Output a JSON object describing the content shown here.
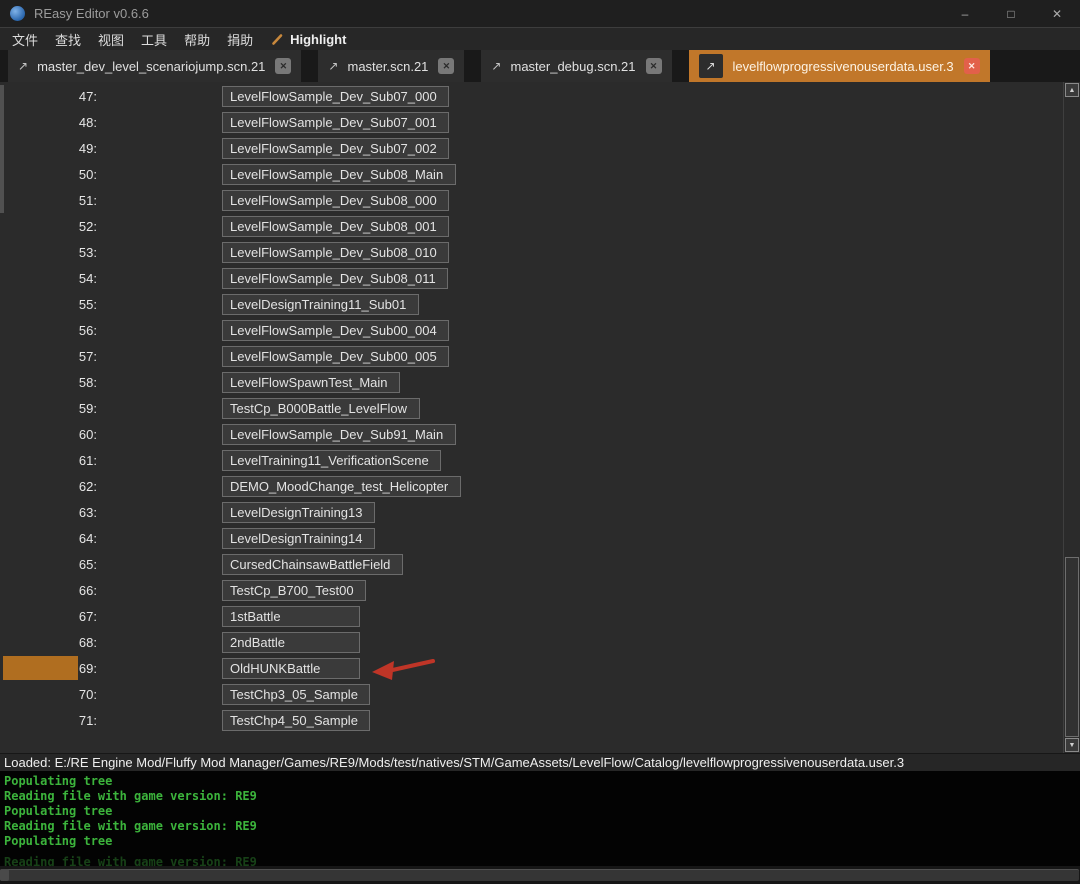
{
  "colors": {
    "accent_orange": "#c1772a",
    "selection_orange": "#b06e20",
    "arrow_red": "#bf3527",
    "console_green": "#3cb43c",
    "active_tab_close": "#e2604a"
  },
  "titlebar": {
    "title": "REasy Editor v0.6.6",
    "minimize": "–",
    "maximize": "□",
    "close": "✕"
  },
  "menu": {
    "items": [
      "文件",
      "查找",
      "视图",
      "工具",
      "帮助",
      "捐助"
    ],
    "highlight": "Highlight"
  },
  "tabs": [
    {
      "label": "master_dev_level_scenariojump.scn.21",
      "active": false
    },
    {
      "label": "master.scn.21",
      "active": false
    },
    {
      "label": "master_debug.scn.21",
      "active": false
    },
    {
      "label": "levelflowprogressivenouserdata.user.3",
      "active": true
    }
  ],
  "list": {
    "rows": [
      {
        "index": "47:",
        "value": "LevelFlowSample_Dev_Sub07_000"
      },
      {
        "index": "48:",
        "value": "LevelFlowSample_Dev_Sub07_001"
      },
      {
        "index": "49:",
        "value": "LevelFlowSample_Dev_Sub07_002"
      },
      {
        "index": "50:",
        "value": "LevelFlowSample_Dev_Sub08_Main"
      },
      {
        "index": "51:",
        "value": "LevelFlowSample_Dev_Sub08_000"
      },
      {
        "index": "52:",
        "value": "LevelFlowSample_Dev_Sub08_001"
      },
      {
        "index": "53:",
        "value": "LevelFlowSample_Dev_Sub08_010"
      },
      {
        "index": "54:",
        "value": "LevelFlowSample_Dev_Sub08_011"
      },
      {
        "index": "55:",
        "value": "LevelDesignTraining11_Sub01"
      },
      {
        "index": "56:",
        "value": "LevelFlowSample_Dev_Sub00_004"
      },
      {
        "index": "57:",
        "value": "LevelFlowSample_Dev_Sub00_005"
      },
      {
        "index": "58:",
        "value": "LevelFlowSpawnTest_Main"
      },
      {
        "index": "59:",
        "value": "TestCp_B000Battle_LevelFlow"
      },
      {
        "index": "60:",
        "value": "LevelFlowSample_Dev_Sub91_Main"
      },
      {
        "index": "61:",
        "value": "LevelTraining11_VerificationScene"
      },
      {
        "index": "62:",
        "value": "DEMO_MoodChange_test_Helicopter"
      },
      {
        "index": "63:",
        "value": "LevelDesignTraining13"
      },
      {
        "index": "64:",
        "value": "LevelDesignTraining14"
      },
      {
        "index": "65:",
        "value": "CursedChainsawBattleField"
      },
      {
        "index": "66:",
        "value": "TestCp_B700_Test00"
      },
      {
        "index": "67:",
        "value": "1stBattle"
      },
      {
        "index": "68:",
        "value": "2ndBattle"
      },
      {
        "index": "69:",
        "value": "OldHUNKBattle",
        "selected": true,
        "arrow": true
      },
      {
        "index": "70:",
        "value": "TestChp3_05_Sample"
      },
      {
        "index": "71:",
        "value": "TestChp4_50_Sample"
      }
    ]
  },
  "statusbar": {
    "text": "Loaded: E:/RE Engine Mod/Fluffy Mod Manager/Games/RE9/Mods/test/natives/STM/GameAssets/LevelFlow/Catalog/levelflowprogressivenouserdata.user.3"
  },
  "console": {
    "lines": [
      "Populating tree",
      "Reading file with game version: RE9",
      "Populating tree",
      "Reading file with game version: RE9",
      "Populating tree"
    ],
    "clipped_line": "Reading file with game version: RE9"
  }
}
